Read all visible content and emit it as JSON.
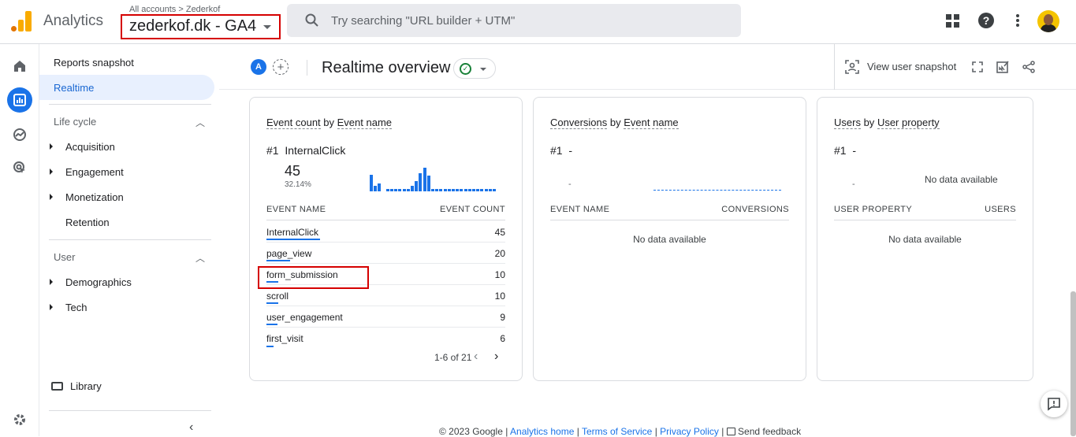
{
  "app": {
    "name": "Analytics"
  },
  "account": {
    "breadcrumb": "All accounts > Zederkof",
    "property": "zederkof.dk - GA4"
  },
  "search": {
    "placeholder": "Try searching \"URL builder + UTM\""
  },
  "icons": {
    "search": "search-icon",
    "apps": "apps-grid-icon",
    "help": "help-icon",
    "more": "more-vert-icon",
    "home": "home-icon",
    "reports": "reports-icon",
    "explore": "explore-icon",
    "advertising": "advertising-icon",
    "settings": "gear-icon"
  },
  "colors": {
    "accent": "#1a73e8",
    "highlight": "#d50000",
    "ok": "#188038",
    "selected_bg": "#e8f0fe"
  },
  "nav": {
    "reports_snapshot": "Reports snapshot",
    "realtime": "Realtime",
    "lifecycle": {
      "title": "Life cycle",
      "items": [
        "Acquisition",
        "Engagement",
        "Monetization",
        "Retention"
      ]
    },
    "user": {
      "title": "User",
      "items": [
        "Demographics",
        "Tech"
      ]
    },
    "library": "Library"
  },
  "header": {
    "comparison_badge": "A",
    "title": "Realtime overview",
    "view_user_snapshot": "View user snapshot"
  },
  "cards": {
    "events": {
      "title_prefix": "Event count",
      "title_by": "by",
      "title_dim": "Event name",
      "rank_label": "#1",
      "top_item": "InternalClick",
      "top_value": "45",
      "top_pct": "32.14%",
      "col_name": "EVENT NAME",
      "col_value": "EVENT COUNT",
      "rows": [
        {
          "name": "InternalClick",
          "value": "45",
          "share": 1.0
        },
        {
          "name": "page_view",
          "value": "20",
          "share": 0.44
        },
        {
          "name": "form_submission",
          "value": "10",
          "share": 0.22
        },
        {
          "name": "scroll",
          "value": "10",
          "share": 0.22
        },
        {
          "name": "user_engagement",
          "value": "9",
          "share": 0.2
        },
        {
          "name": "first_visit",
          "value": "6",
          "share": 0.13
        }
      ],
      "sparkline": [
        18,
        6,
        9,
        0,
        3,
        3,
        3,
        3,
        3,
        3,
        6,
        11,
        20,
        26,
        17,
        3,
        3,
        3,
        3,
        3,
        3,
        3,
        3,
        3,
        3,
        3,
        3,
        3,
        3,
        3,
        3
      ],
      "pager": "1-6 of 21"
    },
    "conversions": {
      "title_prefix": "Conversions",
      "title_by": "by",
      "title_dim": "Event name",
      "rank_label": "#1",
      "top_item": "-",
      "top_value": "-",
      "col_name": "EVENT NAME",
      "col_value": "CONVERSIONS",
      "no_data": "No data available"
    },
    "users": {
      "title_prefix": "Users",
      "title_by": "by",
      "title_dim": "User property",
      "rank_label": "#1",
      "top_item": "-",
      "top_value": "-",
      "chart_no_data": "No data available",
      "col_name": "USER PROPERTY",
      "col_value": "USERS",
      "no_data": "No data available"
    }
  },
  "footer": {
    "copyright": "© 2023 Google |",
    "links": [
      "Analytics home",
      "Terms of Service",
      "Privacy Policy"
    ],
    "sep": "|",
    "feedback": "Send feedback"
  }
}
